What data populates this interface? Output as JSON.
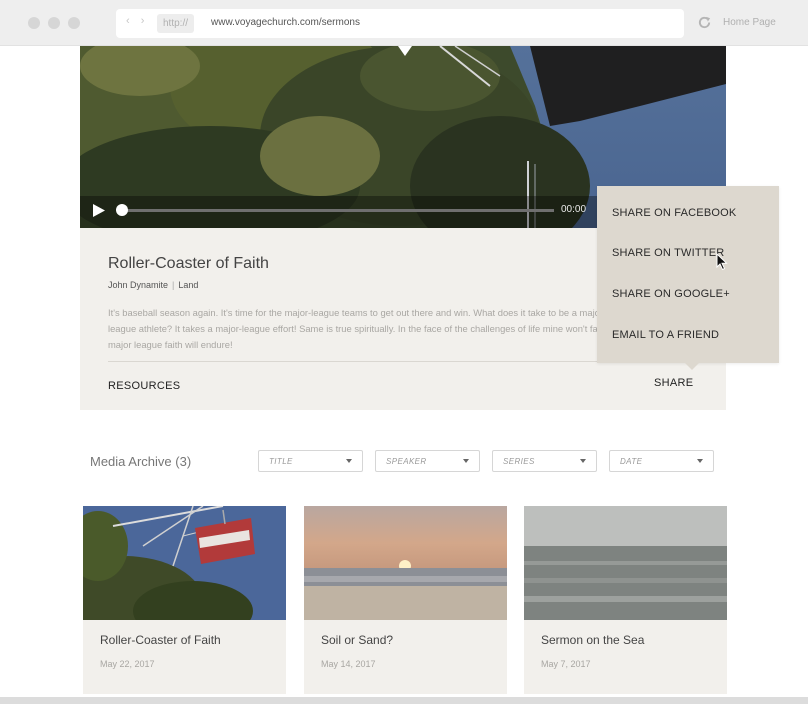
{
  "browser": {
    "protocol": "http://",
    "url": "www.voyagechurch.com/sermons",
    "home_label": "Home Page",
    "nav_arrows": "‹ ›"
  },
  "player": {
    "time": "00:00",
    "progress": 0
  },
  "sermon": {
    "title": "Roller-Coaster of Faith",
    "speaker": "John Dynamite",
    "byline_separator": "|",
    "series": "Land",
    "description": "It's baseball season again. It's time for the major-league teams to get out there and win. What does it take to be a major league athlete? It takes a major-league effort! Same is true spiritually. In the face of the challenges of life mine won't falter; major league faith will endure!",
    "resources_label": "RESOURCES",
    "share_label": "SHARE"
  },
  "share_menu": {
    "items": [
      "SHARE ON FACEBOOK",
      "SHARE ON TWITTER",
      "SHARE ON GOOGLE+",
      "EMAIL TO A FRIEND"
    ],
    "hovered_index": 1
  },
  "archive": {
    "title": "Media Archive (3)",
    "filters": [
      "TITLE",
      "SPEAKER",
      "SERIES",
      "DATE"
    ],
    "items": [
      {
        "title": "Roller-Coaster of Faith",
        "date": "May 22, 2017",
        "thumb": "ferris-wheel-image"
      },
      {
        "title": "Soil or Sand?",
        "date": "May 14, 2017",
        "thumb": "beach-sunset-image"
      },
      {
        "title": "Sermon on the Sea",
        "date": "May 7, 2017",
        "thumb": "sea-waves-image"
      }
    ]
  },
  "colors": {
    "panel_bg": "#f2f0ec",
    "menu_bg": "#ddd8cf",
    "chrome_bg": "#eeeeee"
  }
}
